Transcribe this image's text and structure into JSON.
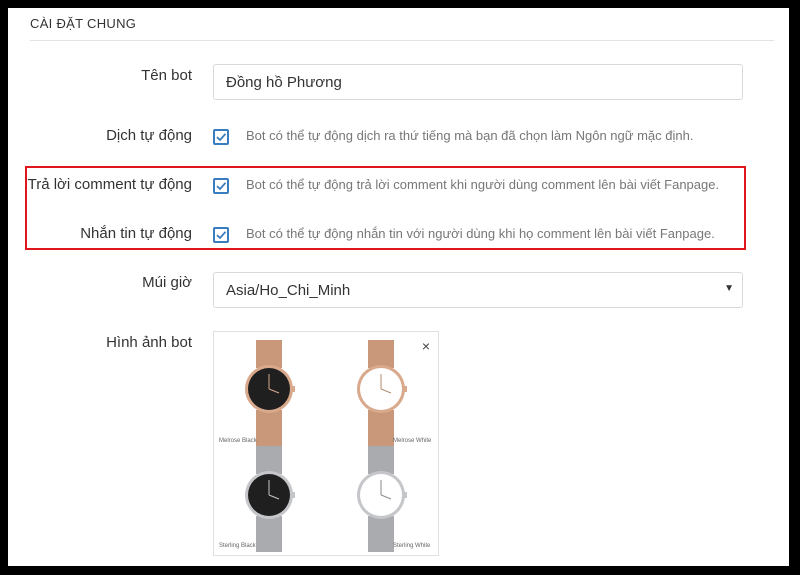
{
  "section": {
    "title": "CÀI ĐẶT CHUNG"
  },
  "fields": {
    "bot_name": {
      "label": "Tên bot",
      "value": "Đồng hồ Phương"
    },
    "auto_translate": {
      "label": "Dịch tự động",
      "checked": true,
      "hint": "Bot có thể tự động dịch ra thứ tiếng mà bạn đã chọn làm Ngôn ngữ mặc định."
    },
    "auto_reply_comment": {
      "label": "Trả lời comment tự động",
      "checked": true,
      "hint": "Bot có thể tự động trả lời comment khi người dùng comment lên bài viết Fanpage."
    },
    "auto_message": {
      "label": "Nhắn tin tự động",
      "checked": true,
      "hint": "Bot có thể tự động nhắn tin với người dùng khi họ comment lên bài viết Fanpage."
    },
    "timezone": {
      "label": "Múi giờ",
      "selected": "Asia/Ho_Chi_Minh"
    },
    "bot_image": {
      "label": "Hình ảnh bot",
      "close_glyph": "×",
      "watches": [
        {
          "caption": "Melrose Black",
          "strap": "#c9977a",
          "dial": "#1f1f1f",
          "case": "#d9a98b"
        },
        {
          "caption": "Melrose White",
          "strap": "#c9977a",
          "dial": "#ffffff",
          "case": "#d9a98b"
        },
        {
          "caption": "Sterling Black",
          "strap": "#a9abae",
          "dial": "#1f1f1f",
          "case": "#c4c6c9"
        },
        {
          "caption": "Sterling White",
          "strap": "#a9abae",
          "dial": "#ffffff",
          "case": "#c4c6c9"
        }
      ]
    }
  },
  "colors": {
    "checkbox": "#3a7cc0",
    "highlight_border": "#e0161b"
  }
}
